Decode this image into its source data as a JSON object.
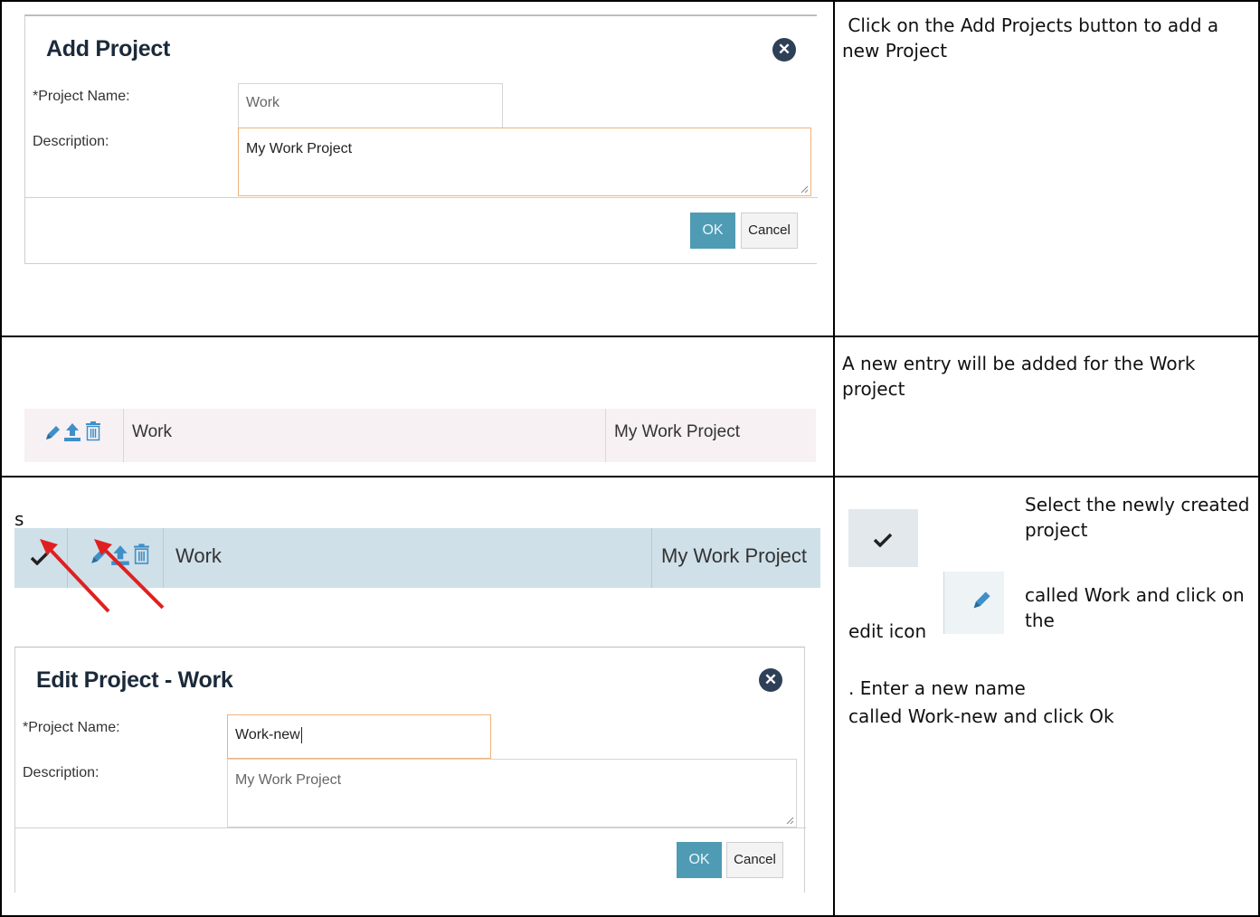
{
  "section1": {
    "instruction": "Click on the Add Projects button to add a new Project",
    "dialog": {
      "title": "Add Project",
      "project_name_label": "*Project Name:",
      "project_name_value": "Work",
      "description_label": "Description:",
      "description_value": "My Work Project",
      "ok_label": "OK",
      "cancel_label": "Cancel"
    }
  },
  "section2": {
    "instruction": "A new entry will be added for the Work project",
    "row": {
      "name": "Work",
      "description": "My Work Project"
    }
  },
  "section3": {
    "stray_char": "s",
    "row": {
      "name": "Work",
      "description": "My Work Project"
    },
    "instruction_select": "Select the newly created project",
    "instruction_called": "called Work and click on the",
    "instruction_edit_icon": "edit icon",
    "instruction_enter": ". Enter a new name",
    "instruction_called_new": "called Work-new and click Ok",
    "dialog": {
      "title": "Edit Project - Work",
      "project_name_label": "*Project Name:",
      "project_name_value": "Work-new",
      "description_label": "Description:",
      "description_value": "My Work Project",
      "ok_label": "OK",
      "cancel_label": "Cancel"
    }
  },
  "colors": {
    "ok_button": "#4f9bb3",
    "selected_row": "#cfe0e8",
    "row_background": "#f7f1f4",
    "icon_blue": "#3f8fc8",
    "arrow_red": "#e02020"
  }
}
